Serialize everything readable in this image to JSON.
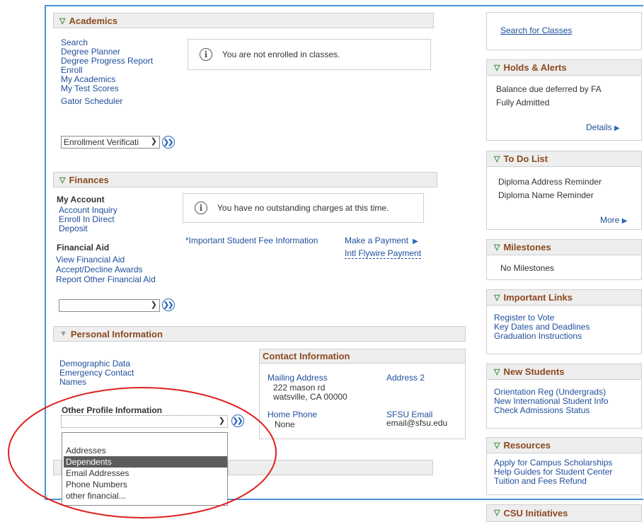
{
  "academics": {
    "title": "Academics",
    "links": [
      "Search",
      "Degree Planner",
      "Degree Progress Report",
      "Enroll",
      "My Academics",
      "My Test Scores",
      "Gator Scheduler"
    ],
    "message": "You are not enrolled in classes.",
    "select_value": "Enrollment Verificati"
  },
  "finances": {
    "title": "Finances",
    "my_account_label": "My Account",
    "my_account_links": [
      "Account Inquiry",
      "Enroll In Direct",
      "Deposit"
    ],
    "financial_aid_label": "Financial Aid",
    "financial_aid_links": [
      "View Financial Aid",
      "Accept/Decline Awards",
      "Report Other Financial Aid"
    ],
    "message": "You have no outstanding charges at this time.",
    "fee_info_link": "*Important Student Fee Information",
    "make_payment_link": "Make a Payment",
    "flywire_link": "Intl Flywire Payment",
    "select_value": ""
  },
  "personal": {
    "title": "Personal Information",
    "links": [
      "Demographic Data",
      "Emergency Contact",
      "Names"
    ],
    "other_profile_label": "Other Profile Information",
    "select_value": "",
    "dropdown_options": [
      "Addresses",
      "Dependents",
      "Email Addresses",
      "Phone Numbers",
      "other financial..."
    ],
    "selected_option": "Dependents"
  },
  "contact": {
    "title": "Contact Information",
    "mailing_address_label": "Mailing Address",
    "mailing_line1": "222 mason rd",
    "mailing_line2": "watsville, CA 00000",
    "address2_label": "Address 2",
    "home_phone_label": "Home Phone",
    "home_phone_value": "None",
    "sfsu_email_label": "SFSU Email",
    "sfsu_email_value": "email@sfsu.edu"
  },
  "sidebar": {
    "search_classes": "Search for Classes",
    "holds": {
      "title": "Holds & Alerts",
      "items": [
        "Balance due deferred by FA",
        "Fully Admitted"
      ],
      "details": "Details"
    },
    "todo": {
      "title": "To Do List",
      "items": [
        "Diploma Address Reminder",
        "Diploma Name Reminder"
      ],
      "more": "More"
    },
    "milestones": {
      "title": "Milestones",
      "text": "No Milestones"
    },
    "important_links": {
      "title": "Important Links",
      "items": [
        "Register to Vote",
        "Key Dates and Deadlines",
        "Graduation Instructions"
      ]
    },
    "new_students": {
      "title": "New Students",
      "items": [
        "Orientation Reg (Undergrads)",
        "New International Student Info",
        "Check Admissions Status"
      ]
    },
    "resources": {
      "title": "Resources",
      "items": [
        "Apply for Campus Scholarships",
        "Help Guides for Student Center",
        "Tuition and Fees Refund"
      ]
    },
    "csu": {
      "title": "CSU Initiatives"
    }
  },
  "colors": {
    "header_text": "#8b4a1e",
    "link": "#1f4e9c",
    "triangle": "#3d8f3d",
    "annotation": "#e02020",
    "frame": "#4a90d9"
  },
  "icons": {
    "info": "info-circle-icon",
    "go": "double-chevron-right-icon",
    "expand": "triangle-down-icon"
  }
}
